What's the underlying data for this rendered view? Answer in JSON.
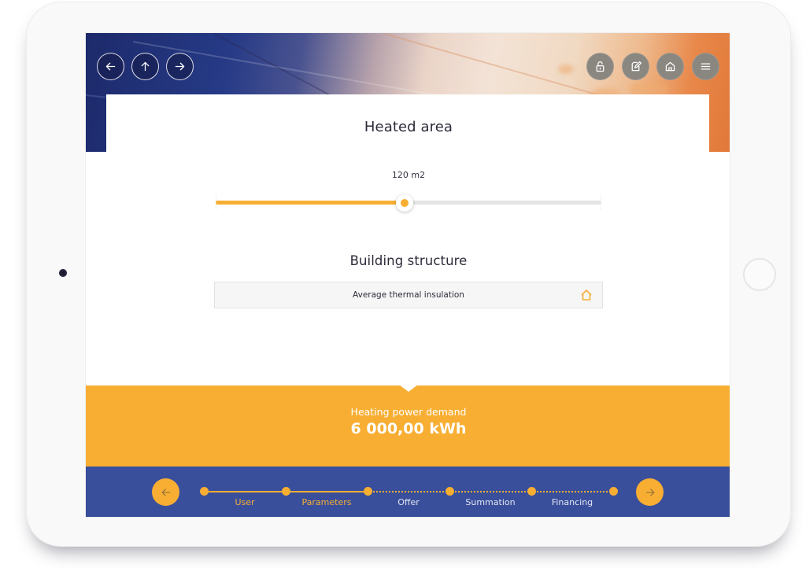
{
  "header": {
    "nav_buttons": [
      {
        "name": "back",
        "icon": "arrow-left-icon"
      },
      {
        "name": "up",
        "icon": "arrow-up-icon"
      },
      {
        "name": "forward",
        "icon": "arrow-right-icon"
      }
    ],
    "tool_buttons": [
      {
        "name": "unlock",
        "icon": "unlock-icon"
      },
      {
        "name": "edit",
        "icon": "edit-document-icon"
      },
      {
        "name": "home",
        "icon": "home-icon"
      },
      {
        "name": "menu",
        "icon": "hamburger-menu-icon"
      }
    ]
  },
  "heated_area": {
    "title": "Heated area",
    "value_label": "120 m2",
    "value": 120,
    "unit": "m2",
    "slider_fill_fraction": 0.49
  },
  "building_structure": {
    "title": "Building structure",
    "selected": "Average thermal insulation",
    "icon": "house-icon"
  },
  "result": {
    "label": "Heating power demand",
    "value": "6 000,00 kWh"
  },
  "stepper": {
    "prev_icon": "arrow-left-icon",
    "next_icon": "arrow-right-icon",
    "steps": [
      {
        "label": "User",
        "state": "done"
      },
      {
        "label": "Parameters",
        "state": "current"
      },
      {
        "label": "Offer",
        "state": "todo"
      },
      {
        "label": "Summation",
        "state": "todo"
      },
      {
        "label": "Financing",
        "state": "todo"
      }
    ]
  },
  "colors": {
    "accent": "#f7ae33",
    "stepper_bg": "#394f9c",
    "text_dark": "#2b2b3a"
  }
}
